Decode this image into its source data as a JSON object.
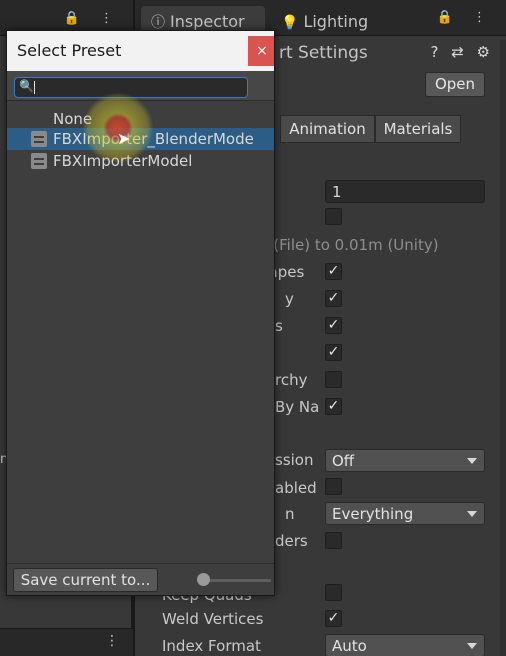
{
  "left_panel": {
    "tab_icons": "🔒 ⋮",
    "bottom_icon": "⋮",
    "edge_glyph": "n"
  },
  "inspector": {
    "tabs": [
      {
        "label": "Inspector",
        "icon": "info-icon",
        "glyph": "ⓘ"
      },
      {
        "label": "Lighting",
        "icon": "lightbulb-icon",
        "glyph": "💡"
      }
    ],
    "tab_icons": "🔒 ⋮",
    "header_title": "rt Settings",
    "header_icons": "? ⇄ ⚙",
    "open_label": "Open",
    "sub_tabs": [
      "Animation",
      "Materials"
    ],
    "properties": [
      {
        "label": "n (File) to 0.01m (Unity)",
        "dim": true
      },
      {
        "label": "hapes",
        "checked": true
      },
      {
        "label": "y",
        "checked": true
      },
      {
        "label": "s",
        "checked": true
      },
      {
        "label": "",
        "checked": true
      },
      {
        "label": "rchy",
        "checked": false
      },
      {
        "label": "By Na",
        "checked": true
      },
      {
        "label": "ssion",
        "dropdown": "Off"
      },
      {
        "label": "abled",
        "checked": false
      },
      {
        "label": "n",
        "dropdown": "Everything"
      },
      {
        "label": "ders",
        "checked": false
      },
      {
        "label": "Keep Quads",
        "checked": false
      },
      {
        "label": "Weld Vertices",
        "checked": true
      },
      {
        "label": "Index Format",
        "dropdown": "Auto"
      }
    ],
    "scale_value": "1"
  },
  "popup": {
    "title": "Select Preset",
    "close_glyph": "×",
    "search_value": "",
    "items": [
      {
        "label": "None"
      },
      {
        "label": "FBXImporter_BlenderMode",
        "selected": true
      },
      {
        "label": "FBXImporterModel"
      }
    ],
    "save_label": "Save current to...",
    "zoom_fraction": 0.0
  },
  "colors": {
    "selection": "#2c5d87",
    "close_button": "#d9534f",
    "search_focus": "#3f78c4"
  }
}
